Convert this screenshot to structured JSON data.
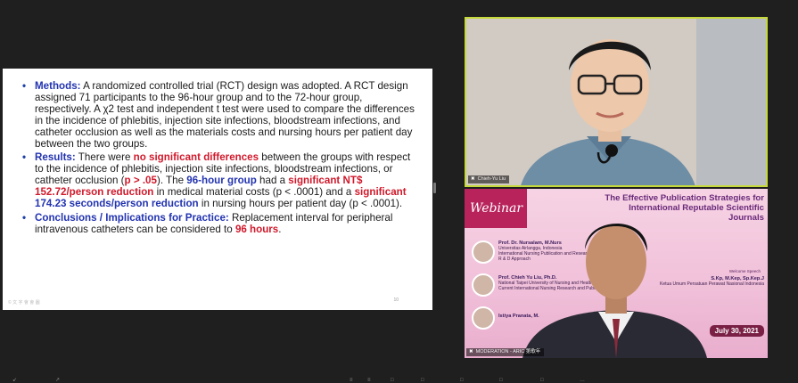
{
  "slide": {
    "bullets": [
      {
        "id": "methods",
        "parts": [
          {
            "text": "Methods:",
            "style": "heading"
          },
          {
            "text": " A randomized controlled trial (RCT) design was adopted. A RCT design assigned 71 participants to the 96-hour group and to the 72-hour group, respectively. A χ2 test and independent t test were used to compare the differences in the incidence of phlebitis, injection site infections, bloodstream infections, and catheter occlusion as well as the materials costs and nursing hours per patient day between the two groups.",
            "style": "plain"
          }
        ]
      },
      {
        "id": "results",
        "parts": [
          {
            "text": "Results:",
            "style": "heading"
          },
          {
            "text": " There were ",
            "style": "plain"
          },
          {
            "text": "no significant differences",
            "style": "red"
          },
          {
            "text": " between the groups with respect to the incidence of phlebitis, injection site infections, bloodstream infections, or catheter occlusion (",
            "style": "plain"
          },
          {
            "text": "p > .05",
            "style": "red"
          },
          {
            "text": "). The ",
            "style": "plain"
          },
          {
            "text": "96-hour group",
            "style": "blue"
          },
          {
            "text": " had a ",
            "style": "plain"
          },
          {
            "text": "significant NT$ 152.72/person reduction",
            "style": "red"
          },
          {
            "text": " in medical material costs (p < .0001) and a ",
            "style": "plain"
          },
          {
            "text": "significant",
            "style": "red"
          },
          {
            "text": " ",
            "style": "plain"
          },
          {
            "text": "174.23 seconds/person reduction",
            "style": "blue"
          },
          {
            "text": " in nursing hours per patient day (p < .0001).",
            "style": "plain"
          }
        ]
      },
      {
        "id": "conclusions",
        "parts": [
          {
            "text": "Conclusions / Implications for Practice:",
            "style": "heading"
          },
          {
            "text": " Replacement interval for peripheral intravenous catheters can be considered to ",
            "style": "plain"
          },
          {
            "text": "96 hours",
            "style": "red"
          },
          {
            "text": ".",
            "style": "plain"
          }
        ]
      }
    ],
    "page_number": "10",
    "watermark": "© 文 字 會 會 圖"
  },
  "speaker_tile": {
    "name": "Chieh-Yu Liu",
    "icon": "muted-mic-icon"
  },
  "moderator_tile": {
    "name": "MODERATION - ARIC 第歌年",
    "icon": "muted-mic-icon",
    "banner": {
      "webinar": "Webinar",
      "title": "The Effective Publication Strategies for International Reputable Scientific Journals",
      "date": "July 30, 2021",
      "speaker1_name": "Prof. Dr. Nursalam, M.Nurs",
      "speaker1_role": "Universitas Airlangga, Indonesia",
      "speaker1_topic": "International Nursing Publication and Research",
      "speaker1_sub": "R & D Approach",
      "speaker2_name": "Prof. Chieh Yu Liu, Ph.D.",
      "speaker2_role": "National Taipei University of Nursing and Health Sciences",
      "speaker2_topic": "Current International Nursing Research and Publication",
      "speaker3_name": "Istiya Pranata, M.",
      "welcome": "Welcome Speech",
      "welcome_name": "S.Kp, M.Kep, Sp.Kep.J",
      "welcome_role": "Ketua Umum Persatuan Perawat Nasional Indonesia"
    }
  },
  "accent_color": "#c6d93b",
  "toolbar_icons": [
    "↙",
    "↗",
    "≡",
    "≡",
    "□",
    "□",
    "□",
    "□",
    "□",
    "…"
  ]
}
